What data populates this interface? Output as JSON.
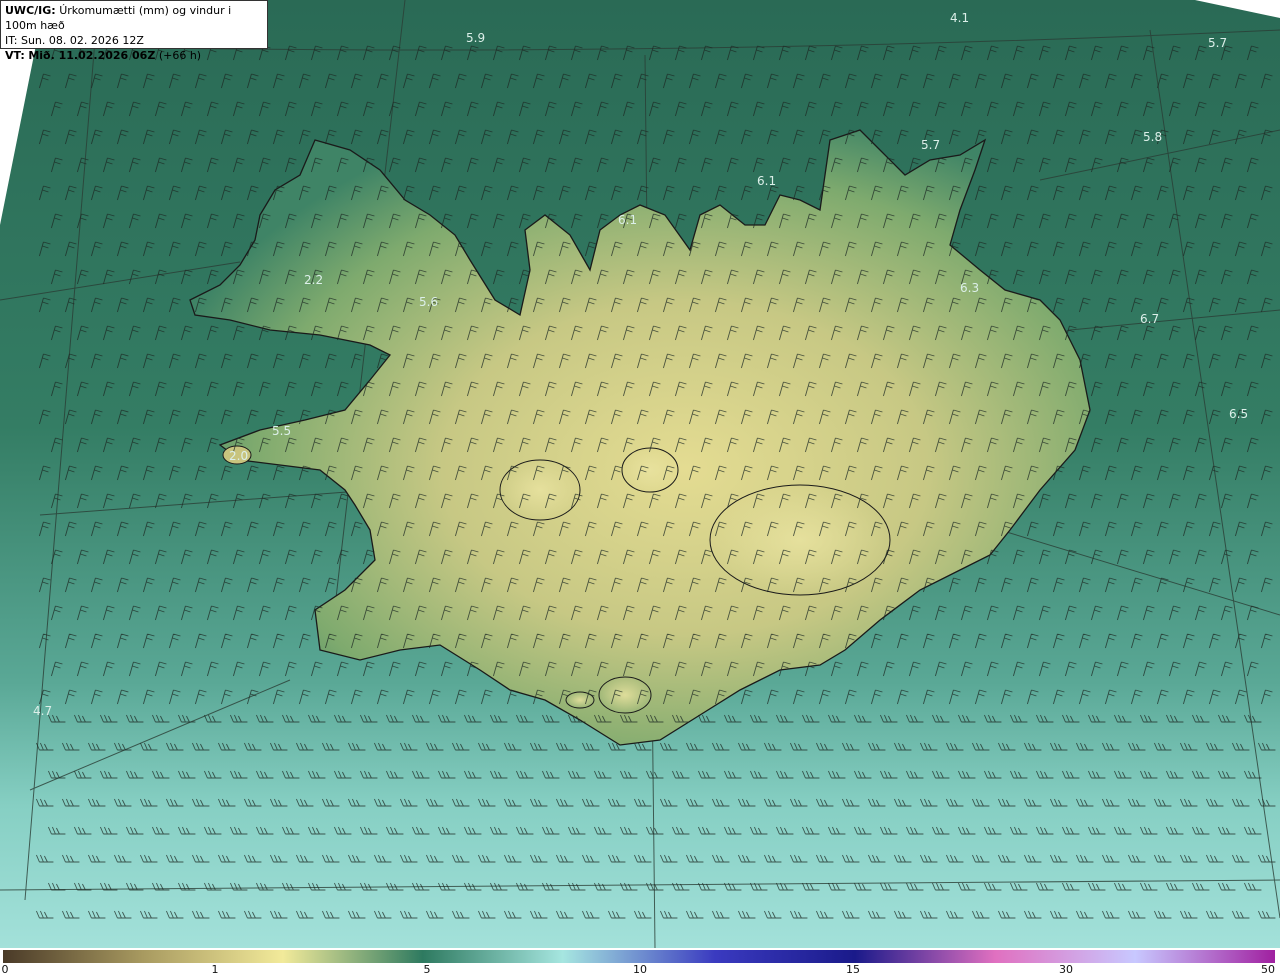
{
  "header": {
    "model": "UWC/IG:",
    "title": "Úrkomumætti (mm) og vindur i 100m hæð",
    "it_label": "IT:",
    "it_value": "Sun. 08. 02. 2026 12Z",
    "vt_label": "VT:",
    "vt_value": "Mið. 11.02.2026 06Z",
    "lead": "(+66 h)"
  },
  "value_labels": [
    {
      "text": "4.1",
      "id": "n-east-top"
    },
    {
      "text": "5.9",
      "id": "north-top"
    },
    {
      "text": "5.7",
      "id": "ne-corner"
    },
    {
      "text": "5.8",
      "id": "ne-sea"
    },
    {
      "text": "5.7",
      "id": "north-coast"
    },
    {
      "text": "6.1",
      "id": "north-central"
    },
    {
      "text": "6.1",
      "id": "north-fjord"
    },
    {
      "text": "2.2",
      "id": "westfjords"
    },
    {
      "text": "5.6",
      "id": "west-fjord"
    },
    {
      "text": "6.3",
      "id": "east-coast"
    },
    {
      "text": "6.7",
      "id": "east-sea"
    },
    {
      "text": "6.5",
      "id": "east-far"
    },
    {
      "text": "5.5",
      "id": "snaefellsnes"
    },
    {
      "text": "2.0",
      "id": "snaefellsnes-tip"
    },
    {
      "text": "4.7",
      "id": "southwest-sea"
    }
  ],
  "legend": {
    "unit": "mm",
    "ticks": [
      "0",
      "1",
      "5",
      "10",
      "15",
      "30",
      "50"
    ],
    "colors": [
      "#4a3a28",
      "#a89a60",
      "#f2ea9a",
      "#2e7a60",
      "#a6e6e0",
      "#3a3ac0",
      "#1a1a8a",
      "#e070c0",
      "#c8c8ff",
      "#a020a0"
    ]
  },
  "palette": {
    "sea_dark": "#2c6d57",
    "sea_mid": "#3b8a70",
    "sea_light": "#8fd6cc",
    "land_green": "#5f9a66",
    "land_yellow": "#d8d48a",
    "coast": "#1a1a1a",
    "barb": "#1e2a24"
  },
  "icons": {
    "wind_barb": "wind-barb-icon"
  }
}
